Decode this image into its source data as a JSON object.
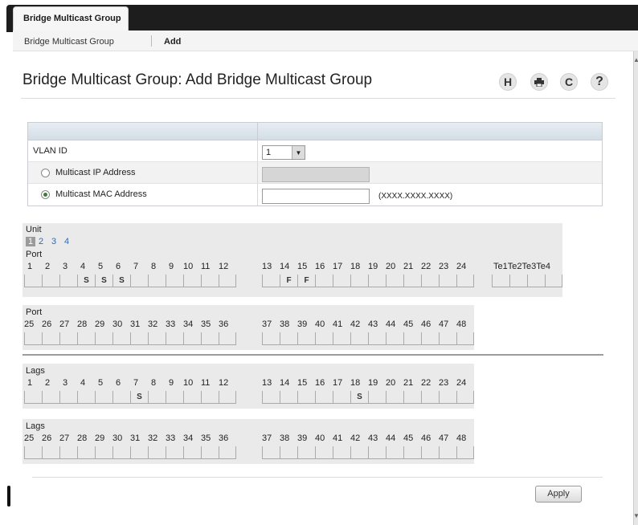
{
  "top_tab": "Bridge Multicast Group",
  "subnav": {
    "crumb": "Bridge Multicast Group",
    "current": "Add"
  },
  "page_title": "Bridge Multicast Group: Add Bridge Multicast Group",
  "toolbar": {
    "save_glyph": "H",
    "print_icon": "printer-icon",
    "refresh_glyph": "C",
    "help_glyph": "?"
  },
  "form": {
    "vlan_label": "VLAN ID",
    "vlan_value": "1",
    "ip_label": "Multicast IP Address",
    "mac_label": "Multicast MAC Address",
    "mac_value": "",
    "mac_hint": "(XXXX.XXXX.XXXX)",
    "selected_radio": "mac"
  },
  "unit": {
    "label": "Unit",
    "options": [
      "1",
      "2",
      "3",
      "4"
    ],
    "selected": "1"
  },
  "ports1": {
    "label": "Port",
    "groupA": [
      "1",
      "2",
      "3",
      "4",
      "5",
      "6",
      "7",
      "8",
      "9",
      "10",
      "11",
      "12"
    ],
    "groupA_vals": [
      "",
      "",
      "",
      "S",
      "S",
      "S",
      "",
      "",
      "",
      "",
      "",
      ""
    ],
    "groupB": [
      "13",
      "14",
      "15",
      "16",
      "17",
      "18",
      "19",
      "20",
      "21",
      "22",
      "23",
      "24"
    ],
    "groupB_vals": [
      "",
      "F",
      "F",
      "",
      "",
      "",
      "",
      "",
      "",
      "",
      "",
      ""
    ],
    "te_label": "Te1Te2Te3Te4",
    "te_vals": [
      "",
      "",
      "",
      ""
    ]
  },
  "ports2": {
    "label": "Port",
    "groupA": [
      "25",
      "26",
      "27",
      "28",
      "29",
      "30",
      "31",
      "32",
      "33",
      "34",
      "35",
      "36"
    ],
    "groupA_vals": [
      "",
      "",
      "",
      "",
      "",
      "",
      "",
      "",
      "",
      "",
      "",
      ""
    ],
    "groupB": [
      "37",
      "38",
      "39",
      "40",
      "41",
      "42",
      "43",
      "44",
      "45",
      "46",
      "47",
      "48"
    ],
    "groupB_vals": [
      "",
      "",
      "",
      "",
      "",
      "",
      "",
      "",
      "",
      "",
      "",
      ""
    ]
  },
  "lags1": {
    "label": "Lags",
    "groupA": [
      "1",
      "2",
      "3",
      "4",
      "5",
      "6",
      "7",
      "8",
      "9",
      "10",
      "11",
      "12"
    ],
    "groupA_vals": [
      "",
      "",
      "",
      "",
      "",
      "",
      "S",
      "",
      "",
      "",
      "",
      ""
    ],
    "groupB": [
      "13",
      "14",
      "15",
      "16",
      "17",
      "18",
      "19",
      "20",
      "21",
      "22",
      "23",
      "24"
    ],
    "groupB_vals": [
      "",
      "",
      "",
      "",
      "",
      "S",
      "",
      "",
      "",
      "",
      "",
      ""
    ]
  },
  "lags2": {
    "label": "Lags",
    "groupA": [
      "25",
      "26",
      "27",
      "28",
      "29",
      "30",
      "31",
      "32",
      "33",
      "34",
      "35",
      "36"
    ],
    "groupA_vals": [
      "",
      "",
      "",
      "",
      "",
      "",
      "",
      "",
      "",
      "",
      "",
      ""
    ],
    "groupB": [
      "37",
      "38",
      "39",
      "40",
      "41",
      "42",
      "43",
      "44",
      "45",
      "46",
      "47",
      "48"
    ],
    "groupB_vals": [
      "",
      "",
      "",
      "",
      "",
      "",
      "",
      "",
      "",
      "",
      "",
      ""
    ]
  },
  "apply_label": "Apply"
}
